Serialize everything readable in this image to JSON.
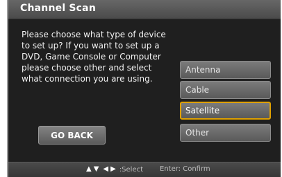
{
  "dialog": {
    "title": "Channel Scan",
    "message": "Please choose what type of device to set up? If you want to set up a DVD, Game Console or Computer please choose other and select what connection you are using.",
    "back_label": "GO BACK"
  },
  "options": [
    {
      "label": "Antenna",
      "selected": false
    },
    {
      "label": "Cable",
      "selected": false
    },
    {
      "label": "Satellite",
      "selected": true
    },
    {
      "label": "Other",
      "selected": false
    }
  ],
  "footer": {
    "nav_icons": [
      "arrow-up-icon",
      "arrow-down-icon",
      "arrow-left-icon",
      "arrow-right-icon"
    ],
    "nav_label": ":Select",
    "confirm_label": "Enter: Confirm"
  },
  "colors": {
    "highlight": "#e0a100",
    "background": "#1f1f1f"
  }
}
